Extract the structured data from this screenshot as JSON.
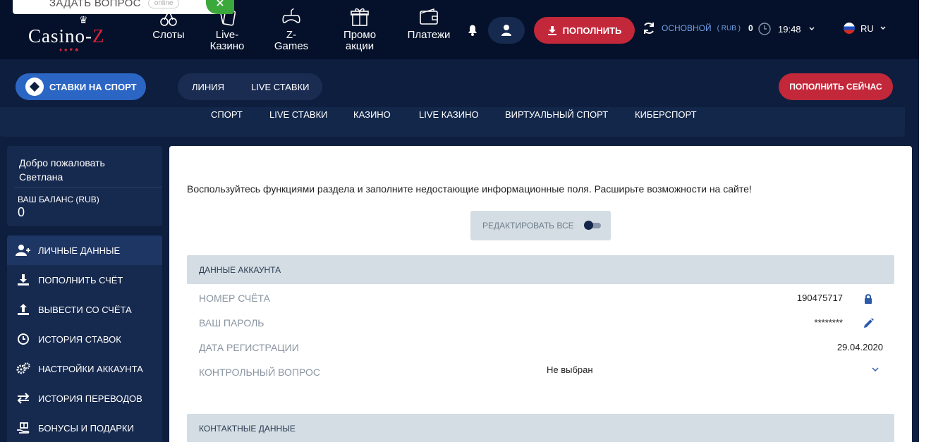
{
  "ask_widget": {
    "label": "ЗАДАТЬ ВОПРОС",
    "status": "online"
  },
  "logo": {
    "text_left": "Casino-",
    "text_right": "Z"
  },
  "nav": [
    {
      "label": "Слоты",
      "icon": "cherries-icon"
    },
    {
      "label": "Live-Казино",
      "line1": "Live-",
      "line2": "Казино",
      "icon": "cards-icon"
    },
    {
      "label": "Z-Games",
      "line1": "Z-",
      "line2": "Games",
      "icon": "gamepad-icon"
    },
    {
      "label": "Промо акции",
      "line1": "Промо",
      "line2": "акции",
      "icon": "gift-icon"
    },
    {
      "label": "Платежи",
      "icon": "wallet-icon"
    }
  ],
  "header": {
    "deposit_label": "ПОПОЛНИТЬ",
    "account_label": "ОСНОВНОЙ",
    "account_currency": "( RUB )",
    "account_amount": "0",
    "time": "19:48",
    "language": "RU"
  },
  "sportbar": {
    "sport_button": "СТАВКИ НА СПОРТ",
    "line": "ЛИНИЯ",
    "live": "LIVE СТАВКИ",
    "deposit_now": "ПОПОЛНИТЬ СЕЙЧАС"
  },
  "subnav": [
    "СПОРТ",
    "LIVE СТАВКИ",
    "КАЗИНО",
    "LIVE КАЗИНО",
    "ВИРТУАЛЬНЫЙ СПОРТ",
    "КИБЕРСПОРТ"
  ],
  "welcome": {
    "greeting": "Добро пожаловать",
    "name": "Светлана",
    "balance_label": "ВАШ БАЛАНС (RUB)",
    "balance_value": "0"
  },
  "menu": [
    {
      "label": "ЛИЧНЫЕ ДАННЫЕ",
      "icon": "user-plus-icon",
      "active": true
    },
    {
      "label": "ПОПОЛНИТЬ СЧЁТ",
      "icon": "download-icon"
    },
    {
      "label": "ВЫВЕСТИ СО СЧЁТА",
      "icon": "upload-icon"
    },
    {
      "label": "ИСТОРИЯ СТАВОК",
      "icon": "clock-icon"
    },
    {
      "label": "НАСТРОЙКИ АККАУНТА",
      "icon": "gears-icon"
    },
    {
      "label": "ИСТОРИЯ ПЕРЕВОДОВ",
      "icon": "transfer-icon"
    },
    {
      "label": "БОНУСЫ И ПОДАРКИ",
      "icon": "gift-hand-icon"
    }
  ],
  "content": {
    "intro": "Воспользуйтесь функциями раздела и заполните недостающие информационные поля. Расширьте возможности на сайте!",
    "edit_all": "РЕДАКТИРОВАТЬ ВСЕ",
    "edit_all_enabled": false,
    "account_section": "ДАННЫЕ АККАУНТА",
    "contact_section": "КОНТАКТНЫЕ ДАННЫЕ",
    "rows": {
      "account_number": {
        "label": "НОМЕР СЧЁТА",
        "value": "190475717",
        "icon": "lock-icon"
      },
      "password": {
        "label": "ВАШ ПАРОЛЬ",
        "value": "********",
        "icon": "pencil-icon"
      },
      "reg_date": {
        "label": "ДАТА РЕГИСТРАЦИИ",
        "value": "29.04.2020"
      },
      "security_question": {
        "label": "КОНТРОЛЬНЫЙ ВОПРОС",
        "value": "Не выбран",
        "icon": "chevron-down-icon"
      }
    }
  },
  "colors": {
    "header_bg": "#05112a",
    "page_bg": "#0e1e3e",
    "panel_bg": "#16294e",
    "accent_red": "#c2283a",
    "accent_blue": "#2b66c5",
    "section_bg": "#d4dde4"
  }
}
